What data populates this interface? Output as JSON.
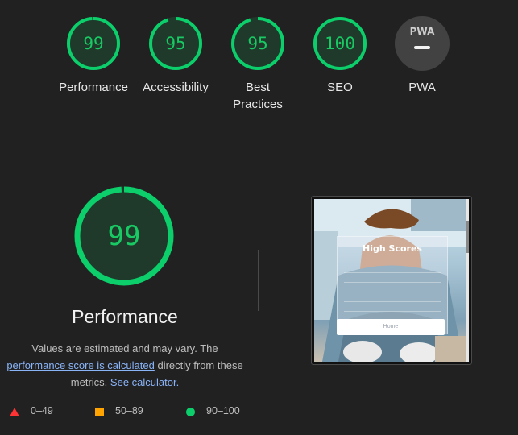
{
  "colors": {
    "pass": "#0cce6b",
    "pass_text": "#18c964",
    "average": "#ffa400",
    "fail": "#ff3333",
    "link": "#8ab4f8",
    "na_bg": "#424242"
  },
  "categories": [
    {
      "label": "Performance",
      "score": "99",
      "value": 99
    },
    {
      "label": "Accessibility",
      "score": "95",
      "value": 95
    },
    {
      "label": "Best Practices",
      "score": "95",
      "value": 95
    },
    {
      "label": "SEO",
      "score": "100",
      "value": 100
    },
    {
      "label": "PWA",
      "logo": "PWA",
      "score": "",
      "value": null
    }
  ],
  "performance": {
    "score": "99",
    "value": 99,
    "title": "Performance",
    "desc_1": "Values are estimated and may vary. The",
    "link_score": "performance score is calculated",
    "desc_2": "directly from these metrics.",
    "link_calc": "See calculator."
  },
  "legend": [
    {
      "icon": "triangle-icon",
      "range": "0–49"
    },
    {
      "icon": "square-icon",
      "range": "50–89"
    },
    {
      "icon": "circle-icon",
      "range": "90–100"
    }
  ],
  "screenshot": {
    "title": "High Scores",
    "button": "Home"
  }
}
